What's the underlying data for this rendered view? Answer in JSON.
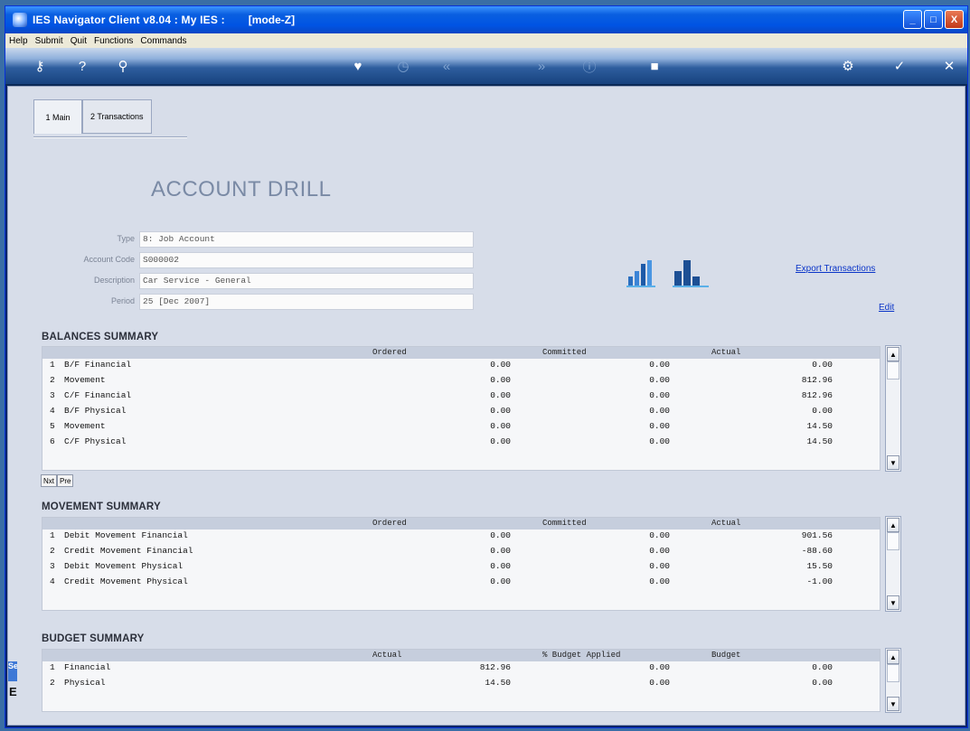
{
  "window": {
    "title": "IES Navigator Client v8.04 : My IES :",
    "mode": "[mode-Z]",
    "minimize": "_",
    "maximize": "□",
    "close": "X"
  },
  "menu": [
    "Help",
    "Submit",
    "Quit",
    "Functions",
    "Commands"
  ],
  "tabs": [
    {
      "label": "1 Main"
    },
    {
      "label": "2 Transactions"
    }
  ],
  "page": {
    "heading": "ACCOUNT DRILL"
  },
  "form": {
    "type_label": "Type",
    "type_value": "8: Job Account",
    "code_label": "Account Code",
    "code_value": "S000002",
    "desc_label": "Description",
    "desc_value": "Car Service - General",
    "period_label": "Period",
    "period_value": "25  [Dec 2007]"
  },
  "links": {
    "export": "Export Transactions",
    "edit": "Edit"
  },
  "balances": {
    "title": "BALANCES SUMMARY",
    "columns": [
      "Ordered",
      "Committed",
      "Actual"
    ],
    "rows": [
      {
        "n": "1",
        "label": "B/F Financial",
        "ordered": "0.00",
        "committed": "0.00",
        "actual": "0.00"
      },
      {
        "n": "2",
        "label": "Movement",
        "ordered": "0.00",
        "committed": "0.00",
        "actual": "812.96"
      },
      {
        "n": "3",
        "label": "C/F Financial",
        "ordered": "0.00",
        "committed": "0.00",
        "actual": "812.96"
      },
      {
        "n": "4",
        "label": "B/F Physical",
        "ordered": "0.00",
        "committed": "0.00",
        "actual": "0.00"
      },
      {
        "n": "5",
        "label": "Movement",
        "ordered": "0.00",
        "committed": "0.00",
        "actual": "14.50"
      },
      {
        "n": "6",
        "label": "C/F Physical",
        "ordered": "0.00",
        "committed": "0.00",
        "actual": "14.50"
      }
    ]
  },
  "nav_buttons": {
    "next": "Nxt",
    "prev": "Pre"
  },
  "movement": {
    "title": "MOVEMENT SUMMARY",
    "columns": [
      "Ordered",
      "Committed",
      "Actual"
    ],
    "rows": [
      {
        "n": "1",
        "label": "Debit  Movement Financial",
        "ordered": "0.00",
        "committed": "0.00",
        "actual": "901.56"
      },
      {
        "n": "2",
        "label": "Credit Movement Financial",
        "ordered": "0.00",
        "committed": "0.00",
        "actual": "-88.60"
      },
      {
        "n": "3",
        "label": "Debit  Movement Physical",
        "ordered": "0.00",
        "committed": "0.00",
        "actual": "15.50"
      },
      {
        "n": "4",
        "label": "Credit Movement Physical",
        "ordered": "0.00",
        "committed": "0.00",
        "actual": "-1.00"
      }
    ]
  },
  "budget": {
    "title": "BUDGET SUMMARY",
    "columns": [
      "Actual",
      "% Budget Applied",
      "Budget"
    ],
    "rows": [
      {
        "n": "1",
        "label": "Financial",
        "c1": "812.96",
        "c2": "0.00",
        "c3": "0.00"
      },
      {
        "n": "2",
        "label": "Physical",
        "c1": "14.50",
        "c2": "0.00",
        "c3": "0.00"
      }
    ]
  },
  "side": {
    "tab_text": "Se",
    "glyph": "E"
  }
}
